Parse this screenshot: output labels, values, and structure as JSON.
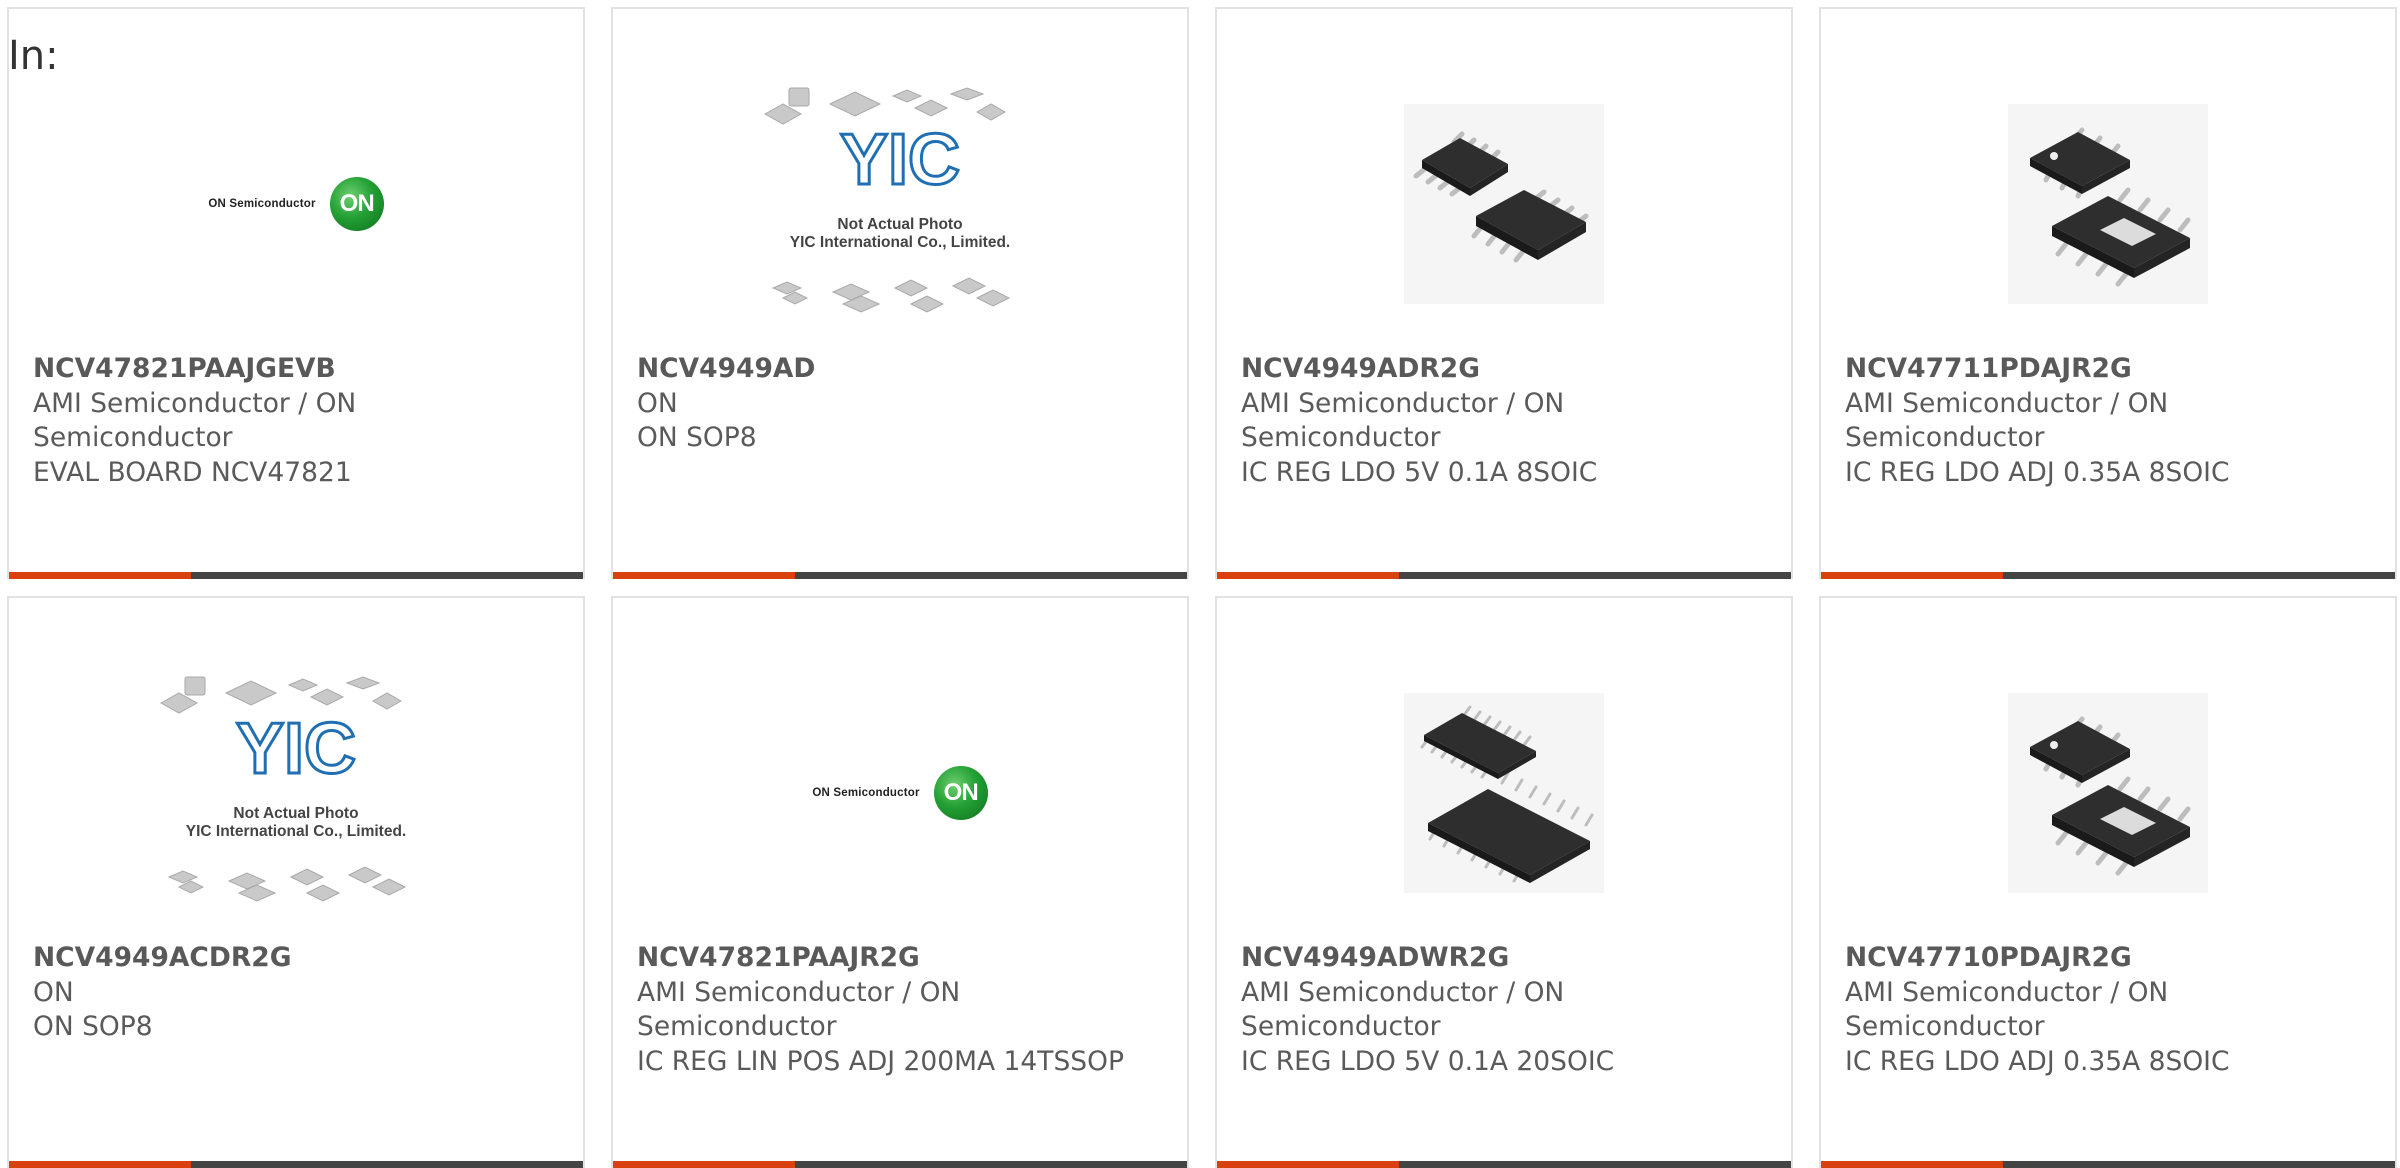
{
  "page": {
    "label": "In:"
  },
  "colors": {
    "accent": "#d9420e",
    "bar": "#444444",
    "text": "#5a5a5a"
  },
  "products": [
    {
      "part": "NCV47821PAAJGEVB",
      "maker": "AMI Semiconductor / ON Semiconductor",
      "desc": "EVAL BOARD NCV47821",
      "image": "on-semiconductor-logo"
    },
    {
      "part": "NCV4949AD",
      "maker": "ON",
      "desc": "ON SOP8",
      "image": "yic-placeholder"
    },
    {
      "part": "NCV4949ADR2G",
      "maker": "AMI Semiconductor / ON Semiconductor",
      "desc": "IC REG LDO 5V 0.1A 8SOIC",
      "image": "soic8-chip-photo"
    },
    {
      "part": "NCV47711PDAJR2G",
      "maker": "AMI Semiconductor / ON Semiconductor",
      "desc": "IC REG LDO ADJ 0.35A 8SOIC",
      "image": "soic8-ep-chip-photo"
    },
    {
      "part": "NCV4949ACDR2G",
      "maker": "ON",
      "desc": "ON SOP8",
      "image": "yic-placeholder"
    },
    {
      "part": "NCV47821PAAJR2G",
      "maker": "AMI Semiconductor / ON Semiconductor",
      "desc": "IC REG LIN POS ADJ 200MA 14TSSOP",
      "image": "on-semiconductor-logo"
    },
    {
      "part": "NCV4949ADWR2G",
      "maker": "AMI Semiconductor / ON Semiconductor",
      "desc": "IC REG LDO 5V 0.1A 20SOIC",
      "image": "soic20-chip-photo"
    },
    {
      "part": "NCV47710PDAJR2G",
      "maker": "AMI Semiconductor / ON Semiconductor",
      "desc": "IC REG LDO ADJ 0.35A 8SOIC",
      "image": "soic8-ep-chip-photo"
    }
  ],
  "logos": {
    "on_text": "ON Semiconductor",
    "on_mark": "ON",
    "yic_mark": "YIC",
    "yic_line1": "Not Actual Photo",
    "yic_line2": "YIC International Co., Limited."
  }
}
